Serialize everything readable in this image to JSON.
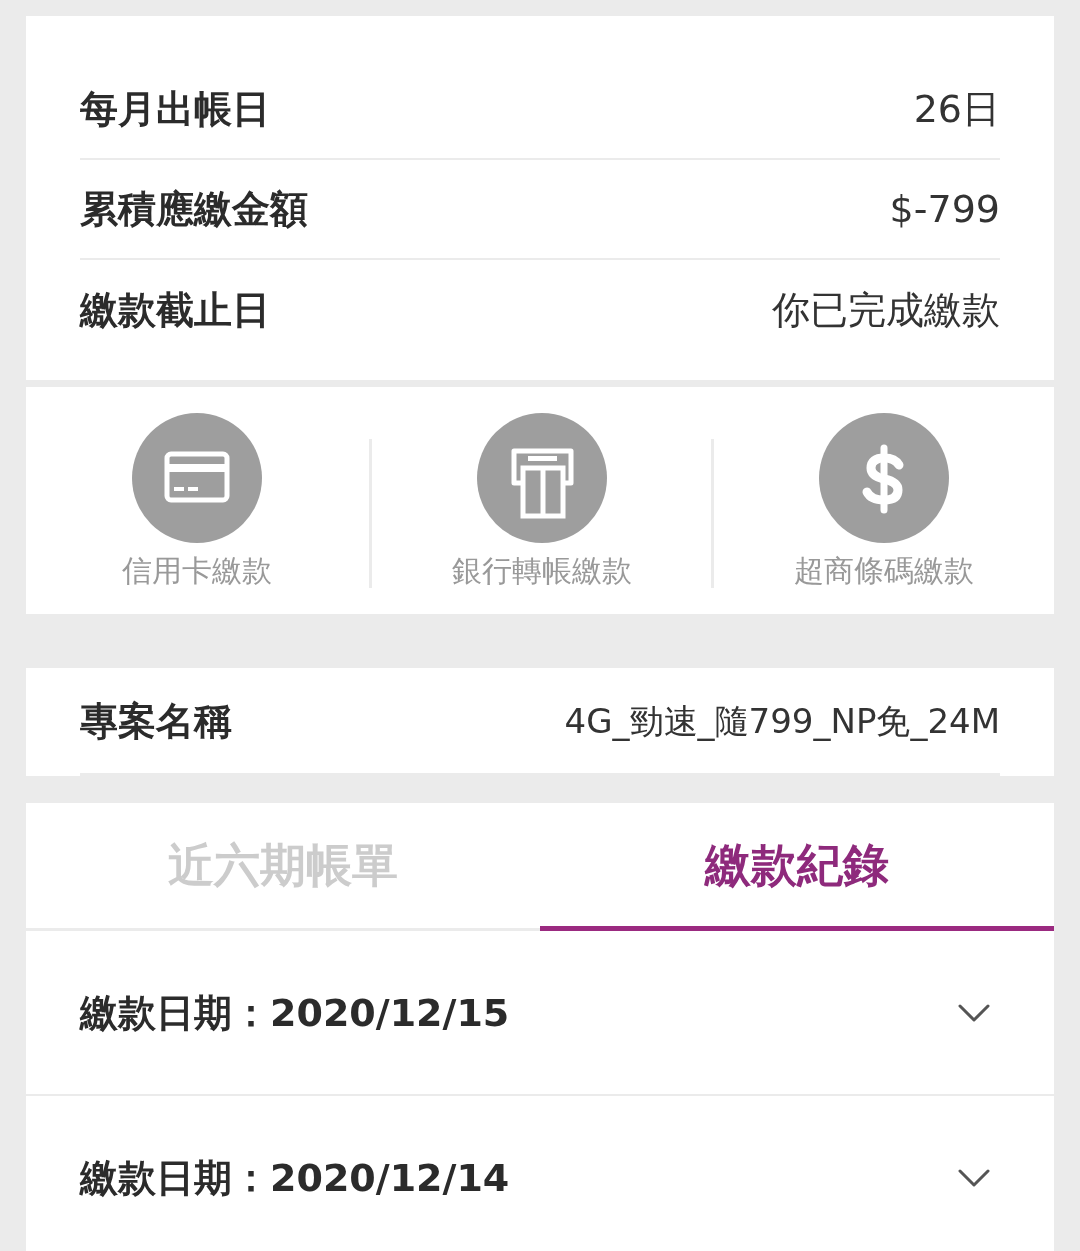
{
  "summary": [
    {
      "label": "每月出帳日",
      "value": "26日"
    },
    {
      "label": "累積應繳金額",
      "value": "$-799"
    },
    {
      "label": "繳款截止日",
      "value": "你已完成繳款"
    }
  ],
  "payment_methods": [
    {
      "kind": "card",
      "label": "信用卡繳款"
    },
    {
      "kind": "bank",
      "label": "銀行轉帳繳款"
    },
    {
      "kind": "store",
      "label": "超商條碼繳款"
    }
  ],
  "plan": {
    "label": "專案名稱",
    "value": "4G_勁速_隨799_NP免_24M"
  },
  "tabs": [
    {
      "label": "近六期帳單",
      "selected": false
    },
    {
      "label": "繳款紀錄",
      "selected": true
    }
  ],
  "records": [
    {
      "label": "繳款日期：2020/12/15",
      "expanded": false
    },
    {
      "label": "繳款日期：2020/12/14",
      "expanded": false
    }
  ]
}
